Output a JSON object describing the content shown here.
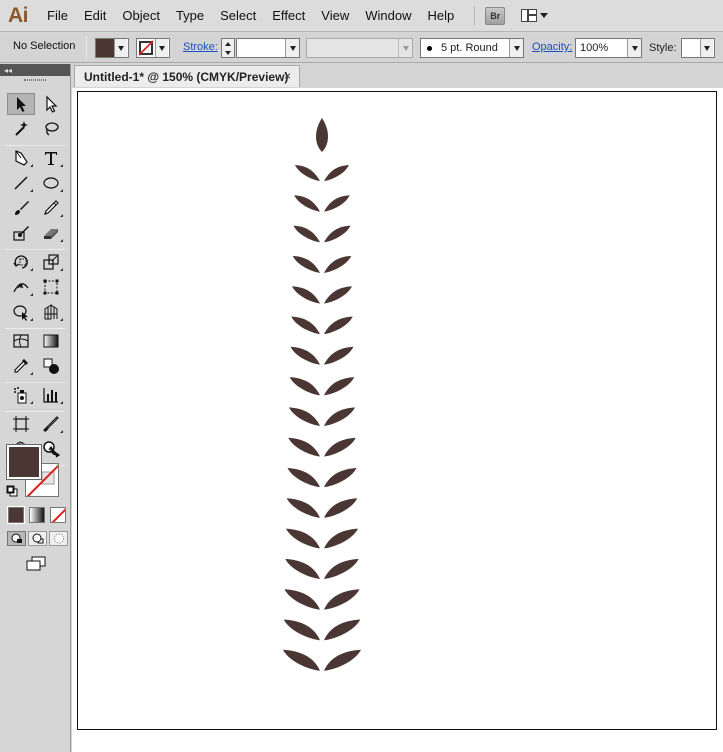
{
  "app": {
    "logo": "Ai"
  },
  "menu": {
    "items": [
      "File",
      "Edit",
      "Object",
      "Type",
      "Select",
      "Effect",
      "View",
      "Window",
      "Help"
    ],
    "bridge_label": "Br"
  },
  "control_bar": {
    "selection": "No Selection",
    "fill_color": "#4a3734",
    "stroke_label": "Stroke:",
    "stroke_weight": "",
    "brush": "5 pt. Round",
    "opacity_label": "Opacity:",
    "opacity": "100%",
    "style_label": "Style:"
  },
  "tools": {
    "fill_color": "#4a3734",
    "stroke_color": "none",
    "icons": [
      "selection-tool",
      "direct-selection-tool",
      "magic-wand-tool",
      "lasso-tool",
      "pen-tool",
      "type-tool",
      "line-segment-tool",
      "ellipse-tool",
      "paintbrush-tool",
      "pencil-tool",
      "blob-brush-tool",
      "eraser-tool",
      "rotate-tool",
      "scale-tool",
      "width-tool",
      "free-transform-tool",
      "shape-builder-tool",
      "perspective-grid-tool",
      "mesh-tool",
      "gradient-tool",
      "eyedropper-tool",
      "blend-tool",
      "symbol-sprayer-tool",
      "column-graph-tool",
      "artboard-tool",
      "slice-tool",
      "hand-tool",
      "zoom-tool"
    ]
  },
  "document": {
    "tab_title": "Untitled-1* @ 150% (CMYK/Preview)",
    "close_glyph": "×"
  },
  "artwork": {
    "leaf_color": "#4a3734",
    "leaf_pairs": 17
  }
}
